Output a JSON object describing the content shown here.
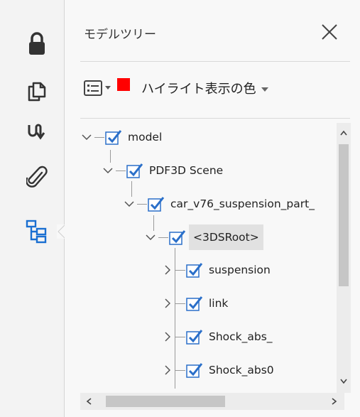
{
  "rail": {
    "icons": [
      "lock-icon",
      "pages-icon",
      "signature-icon",
      "attachment-icon",
      "model-tree-icon"
    ],
    "active": "model-tree-icon"
  },
  "panel": {
    "title": "モデルツリー",
    "highlight_label": "ハイライト表示の色",
    "highlight_color": "#ff0000"
  },
  "tree": {
    "nodes": [
      {
        "label": "model",
        "expanded": true,
        "checked": true,
        "level": 0
      },
      {
        "label": "PDF3D Scene",
        "expanded": true,
        "checked": true,
        "level": 1
      },
      {
        "label": "car_v76_suspension_part_",
        "expanded": true,
        "checked": true,
        "level": 2
      },
      {
        "label": "<3DSRoot>",
        "expanded": true,
        "checked": true,
        "level": 3,
        "selected": true
      },
      {
        "label": "suspension",
        "expanded": false,
        "checked": true,
        "level": 4
      },
      {
        "label": "link",
        "expanded": false,
        "checked": true,
        "level": 4
      },
      {
        "label": "Shock_abs_",
        "expanded": false,
        "checked": true,
        "level": 4
      },
      {
        "label": "Shock_abs0",
        "expanded": false,
        "checked": true,
        "level": 4
      }
    ]
  },
  "colors": {
    "check_blue": "#2a6fc9",
    "highlight_red": "#ff0000"
  }
}
